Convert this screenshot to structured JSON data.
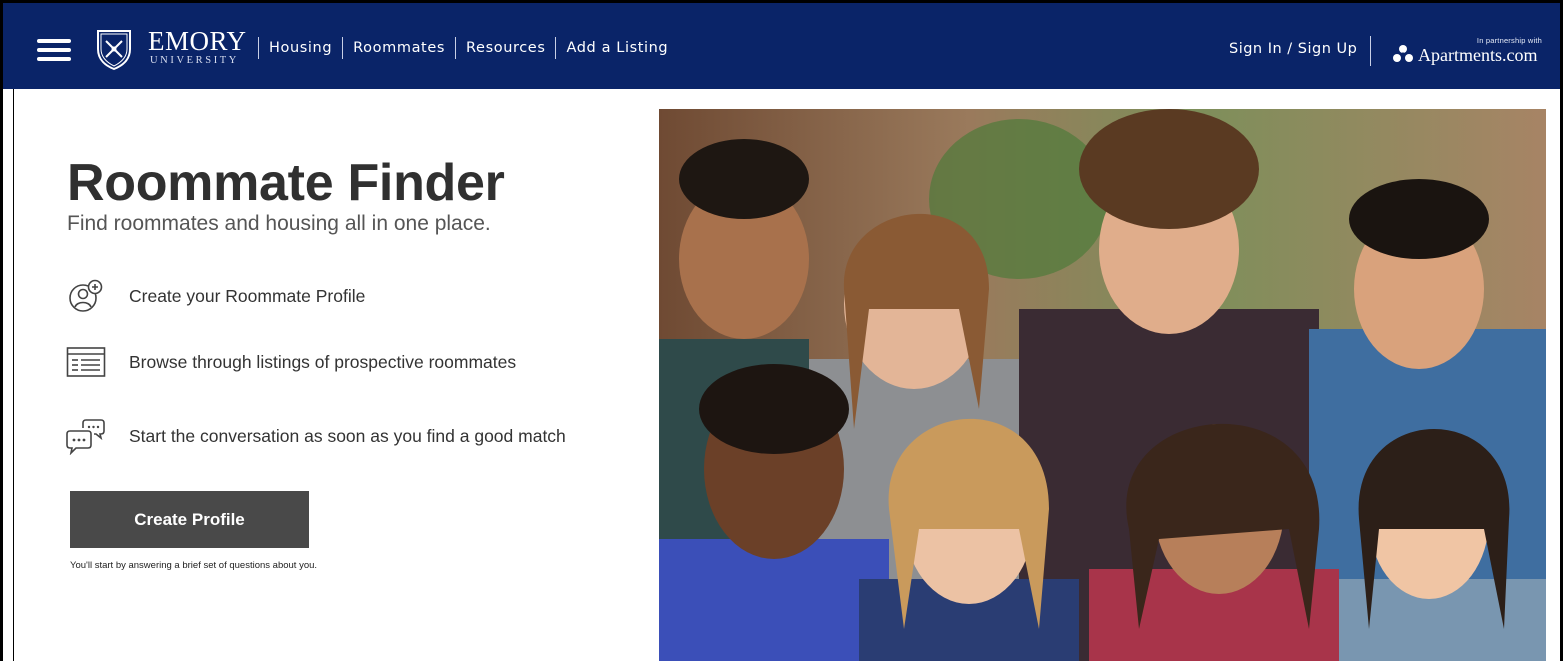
{
  "header": {
    "logo": {
      "name": "EMORY",
      "sub": "UNIVERSITY"
    },
    "nav": [
      {
        "label": "Housing"
      },
      {
        "label": "Roommates"
      },
      {
        "label": "Resources"
      },
      {
        "label": "Add a Listing"
      }
    ],
    "sign_in": "Sign In / Sign Up",
    "partner": {
      "tag": "In partnership with",
      "brand": "Apartments.com"
    }
  },
  "hero": {
    "title": "Roommate Finder",
    "subtitle": "Find roommates and housing all in one place.",
    "features": [
      {
        "icon": "add-profile-icon",
        "text": "Create your Roommate Profile"
      },
      {
        "icon": "listings-icon",
        "text": "Browse through listings of prospective roommates"
      },
      {
        "icon": "chat-bubbles-icon",
        "text": "Start the conversation as soon as you find a good match"
      }
    ],
    "cta_label": "Create Profile",
    "cta_note": "You'll start by answering a brief set of questions about you."
  },
  "colors": {
    "header_bg": "#0a2468",
    "button_bg": "#494949",
    "title": "#303030"
  },
  "image": {
    "subject": "group-of-smiling-students-photo"
  }
}
